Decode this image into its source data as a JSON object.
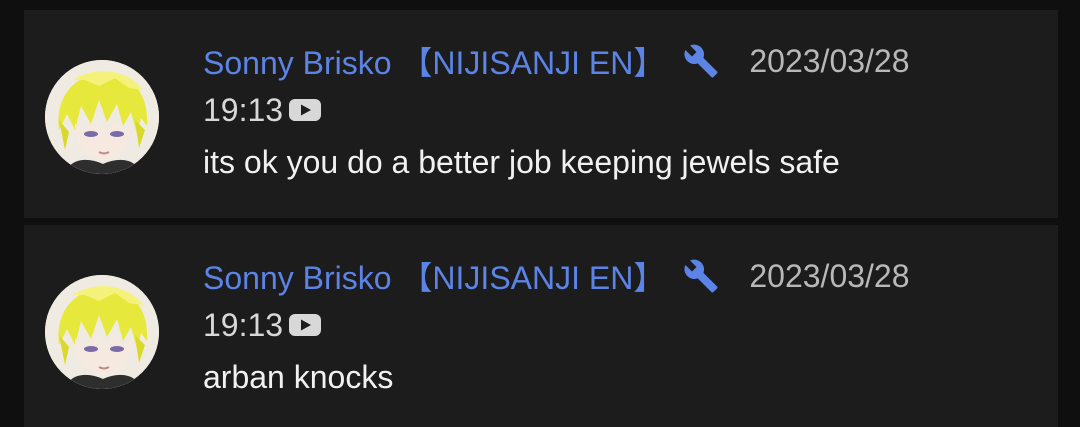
{
  "messages": [
    {
      "author": "Sonny Brisko 【NIJISANJI EN】",
      "date": "2023/03/28",
      "time": "19:13",
      "text": "its ok you do a better job keeping jewels safe",
      "badge_icon": "wrench-icon",
      "platform_icon": "youtube-icon"
    },
    {
      "author": "Sonny Brisko 【NIJISANJI EN】",
      "date": "2023/03/28",
      "time": "19:13",
      "text": "arban knocks",
      "badge_icon": "wrench-icon",
      "platform_icon": "youtube-icon"
    }
  ],
  "colors": {
    "background": "#0f0f0f",
    "card": "#1c1c1c",
    "author": "#5b84e6",
    "date": "#b8b8b8",
    "message": "#f1f1f1"
  }
}
